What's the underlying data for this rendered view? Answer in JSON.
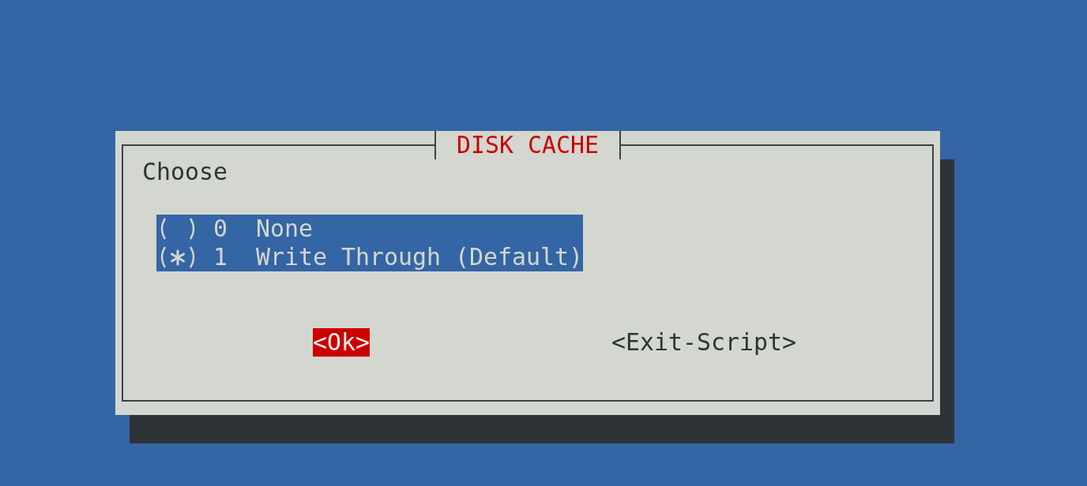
{
  "dialog": {
    "title": "DISK CACHE",
    "prompt": "Choose",
    "options": [
      {
        "tag": "0",
        "label": "None",
        "selected": false
      },
      {
        "tag": "1",
        "label": "Write Through (Default)",
        "selected": true
      }
    ],
    "buttons": [
      {
        "label": "<Ok>",
        "selected": true
      },
      {
        "label": "<Exit-Script>",
        "selected": false
      }
    ]
  }
}
